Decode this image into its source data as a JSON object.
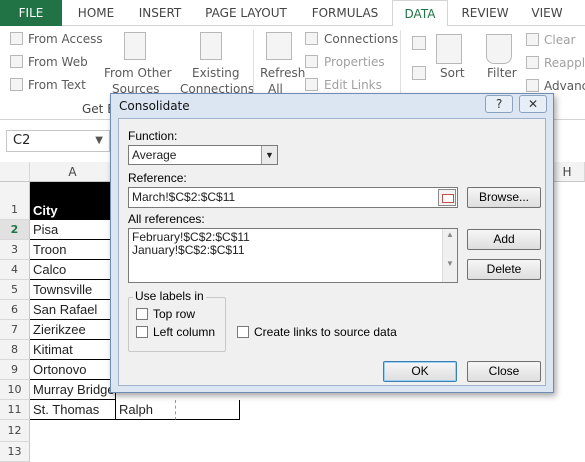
{
  "ribbon": {
    "tabs": [
      "FILE",
      "HOME",
      "INSERT",
      "PAGE LAYOUT",
      "FORMULAS",
      "DATA",
      "REVIEW",
      "VIEW"
    ],
    "active_tab": "DATA",
    "get_external": {
      "from_access": "From Access",
      "from_web": "From Web",
      "from_text": "From Text",
      "from_other_1": "From Other",
      "from_other_2": "Sources",
      "group_label": "Get E"
    },
    "existing_1": "Existing",
    "existing_2": "Connections",
    "refresh_1": "Refresh",
    "refresh_2": "All",
    "connections": "Connections",
    "properties": "Properties",
    "edit_links": "Edit Links",
    "sort": "Sort",
    "filter": "Filter",
    "clear": "Clear",
    "reapply": "Reapply",
    "advanced": "Advanc"
  },
  "namebox": {
    "value": "C2"
  },
  "grid": {
    "columns": [
      "A",
      "H"
    ],
    "rows": [
      "1",
      "2",
      "3",
      "4",
      "5",
      "6",
      "7",
      "8",
      "9",
      "10",
      "11",
      "12",
      "13"
    ],
    "header_cell": "City",
    "cities": [
      "Pisa",
      "Troon",
      "Calco",
      "Townsville",
      "San Rafael",
      "Zierikzee",
      "Kitimat",
      "Ortonovo",
      "Murray Bridge",
      "St. Thomas"
    ],
    "b11": "Ralph"
  },
  "dialog": {
    "title": "Consolidate",
    "help": "?",
    "close": "✕",
    "function_label": "Function:",
    "function_value": "Average",
    "reference_label": "Reference:",
    "reference_value": "March!$C$2:$C$11",
    "browse": "Browse...",
    "all_references_label": "All references:",
    "references": [
      "February!$C$2:$C$11",
      "January!$C$2:$C$11"
    ],
    "add": "Add",
    "delete": "Delete",
    "use_labels_in": "Use labels in",
    "top_row": "Top row",
    "left_column": "Left column",
    "create_links": "Create links to source data",
    "ok": "OK",
    "close_btn": "Close"
  }
}
